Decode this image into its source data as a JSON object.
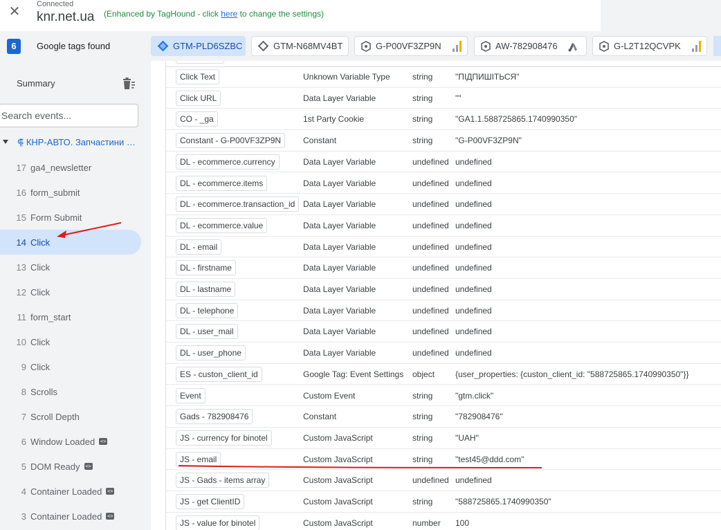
{
  "header": {
    "connected": "Connected",
    "domain": "knr.net.ua",
    "enhanced_prefix": "(Enhanced by TagHound - click ",
    "enhanced_link": "here",
    "enhanced_suffix": " to change the settings)"
  },
  "tags": {
    "count": "6",
    "title": "Google tags found",
    "chips": [
      {
        "label": "GTM-PLD6SZBC",
        "icon": "gtm-diamond-icon",
        "active": true
      },
      {
        "label": "GTM-N68MV4BT",
        "icon": "gtm-diamond-icon",
        "active": false
      },
      {
        "label": "G-P00VF3ZP9N",
        "icon": "google-tag-icon",
        "active": false
      },
      {
        "label": "AW-782908476",
        "icon": "google-tag-icon",
        "active": false
      },
      {
        "label": "G-L2T12QCVPK",
        "icon": "google-tag-icon",
        "active": false
      }
    ]
  },
  "sidebar": {
    "summary": "Summary",
    "search_placeholder": "Search events...",
    "page": "⸿ КНР-АВТО. Запчастини для китайських авто",
    "events": [
      {
        "num": "17",
        "name": "ga4_newsletter",
        "selected": false,
        "code": false
      },
      {
        "num": "16",
        "name": "form_submit",
        "selected": false,
        "code": false
      },
      {
        "num": "15",
        "name": "Form Submit",
        "selected": false,
        "code": false
      },
      {
        "num": "14",
        "name": "Click",
        "selected": true,
        "code": false
      },
      {
        "num": "13",
        "name": "Click",
        "selected": false,
        "code": false
      },
      {
        "num": "12",
        "name": "Click",
        "selected": false,
        "code": false
      },
      {
        "num": "11",
        "name": "form_start",
        "selected": false,
        "code": false
      },
      {
        "num": "10",
        "name": "Click",
        "selected": false,
        "code": false
      },
      {
        "num": "9",
        "name": "Click",
        "selected": false,
        "code": false
      },
      {
        "num": "8",
        "name": "Scrolls",
        "selected": false,
        "code": false
      },
      {
        "num": "7",
        "name": "Scroll Depth",
        "selected": false,
        "code": false
      },
      {
        "num": "6",
        "name": "Window Loaded",
        "selected": false,
        "code": true
      },
      {
        "num": "5",
        "name": "DOM Ready",
        "selected": false,
        "code": true
      },
      {
        "num": "4",
        "name": "Container Loaded",
        "selected": false,
        "code": true
      },
      {
        "num": "3",
        "name": "Container Loaded",
        "selected": false,
        "code": true
      }
    ]
  },
  "variables": [
    {
      "name": "Click Text",
      "type": "Unknown Variable Type",
      "dtype": "string",
      "value": "\"ПІДПИШІТЬСЯ\""
    },
    {
      "name": "Click URL",
      "type": "Data Layer Variable",
      "dtype": "string",
      "value": "\"\""
    },
    {
      "name": "CO - _ga",
      "type": "1st Party Cookie",
      "dtype": "string",
      "value": "\"GA1.1.588725865.1740990350\""
    },
    {
      "name": "Constant - G-P00VF3ZP9N",
      "type": "Constant",
      "dtype": "string",
      "value": "\"G-P00VF3ZP9N\""
    },
    {
      "name": "DL - ecommerce.currency",
      "type": "Data Layer Variable",
      "dtype": "undefined",
      "value": "undefined"
    },
    {
      "name": "DL - ecommerce.items",
      "type": "Data Layer Variable",
      "dtype": "undefined",
      "value": "undefined"
    },
    {
      "name": "DL - ecommerce.transaction_id",
      "type": "Data Layer Variable",
      "dtype": "undefined",
      "value": "undefined"
    },
    {
      "name": "DL - ecommerce.value",
      "type": "Data Layer Variable",
      "dtype": "undefined",
      "value": "undefined"
    },
    {
      "name": "DL - email",
      "type": "Data Layer Variable",
      "dtype": "undefined",
      "value": "undefined"
    },
    {
      "name": "DL - firstname",
      "type": "Data Layer Variable",
      "dtype": "undefined",
      "value": "undefined"
    },
    {
      "name": "DL - lastname",
      "type": "Data Layer Variable",
      "dtype": "undefined",
      "value": "undefined"
    },
    {
      "name": "DL - telephone",
      "type": "Data Layer Variable",
      "dtype": "undefined",
      "value": "undefined"
    },
    {
      "name": "DL - user_mail",
      "type": "Data Layer Variable",
      "dtype": "undefined",
      "value": "undefined"
    },
    {
      "name": "DL - user_phone",
      "type": "Data Layer Variable",
      "dtype": "undefined",
      "value": "undefined"
    },
    {
      "name": "ES - custon_client_id",
      "type": "Google Tag: Event Settings",
      "dtype": "object",
      "value": "{user_properties: {custon_client_id: \"588725865.1740990350\"}}"
    },
    {
      "name": "Event",
      "type": "Custom Event",
      "dtype": "string",
      "value": "\"gtm.click\""
    },
    {
      "name": "Gads - 782908476",
      "type": "Constant",
      "dtype": "string",
      "value": "\"782908476\""
    },
    {
      "name": "JS - currency for binotel",
      "type": "Custom JavaScript",
      "dtype": "string",
      "value": "\"UAH\""
    },
    {
      "name": "JS - email",
      "type": "Custom JavaScript",
      "dtype": "string",
      "value": "\"test45@ddd.com\""
    },
    {
      "name": "JS - Gads - items array",
      "type": "Custom JavaScript",
      "dtype": "undefined",
      "value": "undefined"
    },
    {
      "name": "JS - get ClientID",
      "type": "Custom JavaScript",
      "dtype": "string",
      "value": "\"588725865.1740990350\""
    },
    {
      "name": "JS - value for binotel",
      "type": "Custom JavaScript",
      "dtype": "number",
      "value": "100"
    }
  ],
  "colors": {
    "accent": "#1a73e8",
    "annotation": "#e21b1b",
    "enhanced_text": "#1e8e3e"
  }
}
